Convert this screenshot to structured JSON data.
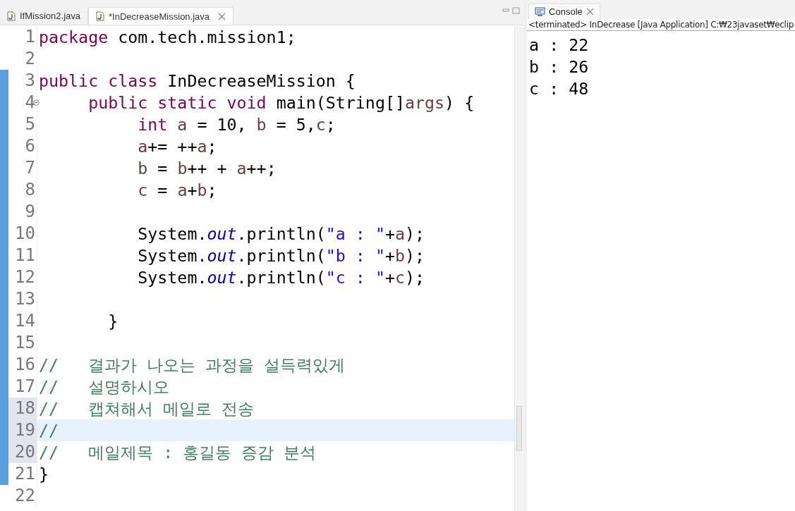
{
  "editor": {
    "tabs": [
      {
        "label": "IfMission2.java",
        "selected": false
      },
      {
        "label": "*InDecreaseMission.java",
        "selected": true
      }
    ],
    "lines": [
      {
        "number": "1",
        "changed": false,
        "current": false,
        "folded": false,
        "highlighted": false,
        "segments": [
          {
            "kind": "keyword",
            "text": "package"
          },
          {
            "kind": "plain",
            "text": " com.tech.mission1;"
          }
        ]
      },
      {
        "number": "2",
        "changed": false,
        "current": false,
        "folded": false,
        "highlighted": false
      },
      {
        "number": "3",
        "changed": true,
        "current": false,
        "folded": false,
        "highlighted": false,
        "segments": [
          {
            "kind": "keyword",
            "text": "public class"
          },
          {
            "kind": "plain",
            "text": " InDecreaseMission {"
          }
        ]
      },
      {
        "number": "4",
        "changed": true,
        "current": false,
        "folded": true,
        "highlighted": false,
        "segments": [
          {
            "kind": "keyword",
            "text": "     public static void"
          },
          {
            "kind": "plain",
            "text": " main(String[]"
          },
          {
            "kind": "variable",
            "text": "args"
          },
          {
            "kind": "plain",
            "text": ") {"
          }
        ]
      },
      {
        "number": "5",
        "changed": true,
        "current": false,
        "folded": false,
        "highlighted": false,
        "segments": [
          {
            "kind": "keyword",
            "text": "          int"
          },
          {
            "kind": "variable",
            "text": " a"
          },
          {
            "kind": "plain",
            "text": " = 10, "
          },
          {
            "kind": "variable",
            "text": "b"
          },
          {
            "kind": "plain",
            "text": " = 5,"
          },
          {
            "kind": "variable",
            "text": "c"
          },
          {
            "kind": "plain",
            "text": ";"
          }
        ]
      },
      {
        "number": "6",
        "changed": true,
        "current": false,
        "folded": false,
        "highlighted": false,
        "segments": [
          {
            "kind": "variable",
            "text": "          a"
          },
          {
            "kind": "plain",
            "text": "+= ++"
          },
          {
            "kind": "variable",
            "text": "a"
          },
          {
            "kind": "plain",
            "text": ";"
          }
        ]
      },
      {
        "number": "7",
        "changed": true,
        "current": false,
        "folded": false,
        "highlighted": false,
        "segments": [
          {
            "kind": "variable",
            "text": "          b"
          },
          {
            "kind": "plain",
            "text": " = "
          },
          {
            "kind": "variable",
            "text": "b"
          },
          {
            "kind": "plain",
            "text": "++ + "
          },
          {
            "kind": "variable",
            "text": "a"
          },
          {
            "kind": "plain",
            "text": "++;"
          }
        ]
      },
      {
        "number": "8",
        "changed": true,
        "current": false,
        "folded": false,
        "highlighted": false,
        "segments": [
          {
            "kind": "variable",
            "text": "          c"
          },
          {
            "kind": "plain",
            "text": " = "
          },
          {
            "kind": "variable",
            "text": "a"
          },
          {
            "kind": "plain",
            "text": "+"
          },
          {
            "kind": "variable",
            "text": "b"
          },
          {
            "kind": "plain",
            "text": ";"
          }
        ]
      },
      {
        "number": "9",
        "changed": true,
        "current": false,
        "folded": false,
        "highlighted": false
      },
      {
        "number": "10",
        "changed": true,
        "current": false,
        "folded": false,
        "highlighted": false,
        "segments": [
          {
            "kind": "plain",
            "text": "          System."
          },
          {
            "kind": "field",
            "text": "out"
          },
          {
            "kind": "plain",
            "text": ".println("
          },
          {
            "kind": "string",
            "text": "\"a : \""
          },
          {
            "kind": "plain",
            "text": "+"
          },
          {
            "kind": "variable",
            "text": "a"
          },
          {
            "kind": "plain",
            "text": ");"
          }
        ]
      },
      {
        "number": "11",
        "changed": true,
        "current": false,
        "folded": false,
        "highlighted": false,
        "segments": [
          {
            "kind": "plain",
            "text": "          System."
          },
          {
            "kind": "field",
            "text": "out"
          },
          {
            "kind": "plain",
            "text": ".println("
          },
          {
            "kind": "string",
            "text": "\"b : \""
          },
          {
            "kind": "plain",
            "text": "+"
          },
          {
            "kind": "variable",
            "text": "b"
          },
          {
            "kind": "plain",
            "text": ");"
          }
        ]
      },
      {
        "number": "12",
        "changed": true,
        "current": false,
        "folded": false,
        "highlighted": false,
        "segments": [
          {
            "kind": "plain",
            "text": "          System."
          },
          {
            "kind": "field",
            "text": "out"
          },
          {
            "kind": "plain",
            "text": ".println("
          },
          {
            "kind": "string",
            "text": "\"c : \""
          },
          {
            "kind": "plain",
            "text": "+"
          },
          {
            "kind": "variable",
            "text": "c"
          },
          {
            "kind": "plain",
            "text": ");"
          }
        ]
      },
      {
        "number": "13",
        "changed": true,
        "current": false,
        "folded": false,
        "highlighted": false
      },
      {
        "number": "14",
        "changed": true,
        "current": false,
        "folded": false,
        "highlighted": false,
        "segments": [
          {
            "kind": "plain",
            "text": "       }"
          }
        ]
      },
      {
        "number": "15",
        "changed": true,
        "current": false,
        "folded": false,
        "highlighted": false
      },
      {
        "number": "16",
        "changed": true,
        "current": false,
        "folded": false,
        "highlighted": false,
        "segments": [
          {
            "kind": "comment",
            "text": "//   결과가 나오는 과정을 설득력있게"
          }
        ]
      },
      {
        "number": "17",
        "changed": true,
        "current": false,
        "folded": false,
        "highlighted": false,
        "segments": [
          {
            "kind": "comment",
            "text": "//   설명하시오"
          }
        ]
      },
      {
        "number": "18",
        "changed": true,
        "current": false,
        "folded": false,
        "highlighted": true,
        "segments": [
          {
            "kind": "comment",
            "text": "//   캡쳐해서 메일로 전송"
          }
        ]
      },
      {
        "number": "19",
        "changed": true,
        "current": true,
        "folded": false,
        "highlighted": true,
        "segments": [
          {
            "kind": "comment",
            "text": "//"
          }
        ]
      },
      {
        "number": "20",
        "changed": true,
        "current": false,
        "folded": false,
        "highlighted": true,
        "segments": [
          {
            "kind": "comment",
            "text": "//   메일제목 : 홍길동 증감 분석"
          }
        ]
      },
      {
        "number": "21",
        "changed": true,
        "current": false,
        "folded": false,
        "highlighted": false,
        "segments": [
          {
            "kind": "plain",
            "text": "}"
          }
        ]
      },
      {
        "number": "22",
        "changed": false,
        "current": false,
        "folded": false,
        "highlighted": false
      }
    ]
  },
  "console": {
    "tab": {
      "label": "Console",
      "selected": true
    },
    "header": "<terminated> InDecrease [Java Application] C:₩23javaset₩eclip",
    "output": [
      "a : 22",
      "b : 26",
      "c : 48"
    ]
  }
}
